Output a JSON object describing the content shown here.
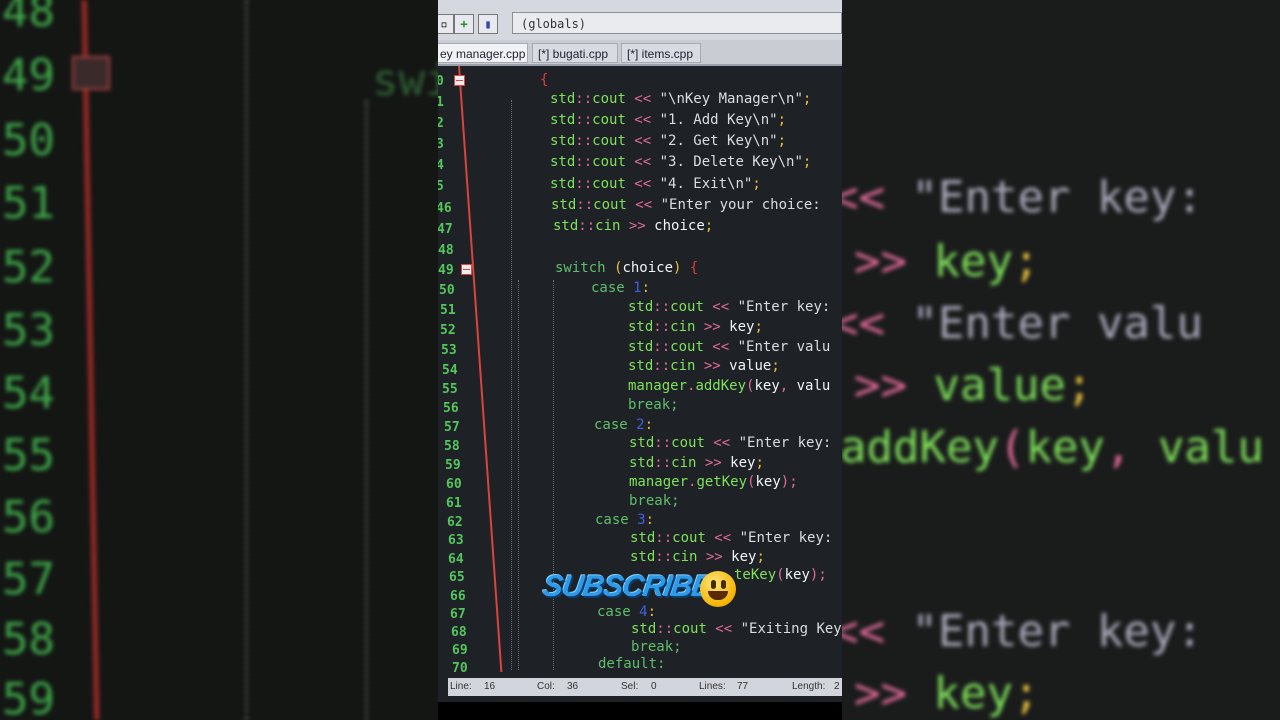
{
  "toolbar": {
    "scope": "(globals)"
  },
  "tabs": [
    {
      "label": "ey manager.cpp",
      "active": true
    },
    {
      "label": "[*] bugati.cpp",
      "active": false
    },
    {
      "label": "[*] items.cpp",
      "active": false
    }
  ],
  "gutter": {
    "top_partial": [
      "0",
      "1",
      "2",
      "3",
      "4",
      "5"
    ],
    "lines": [
      "46",
      "47",
      "48",
      "49",
      "50",
      "51",
      "52",
      "53",
      "54",
      "55",
      "56",
      "57",
      "58",
      "59",
      "60",
      "61",
      "62",
      "63",
      "64",
      "65",
      "66",
      "67",
      "68",
      "69",
      "70"
    ]
  },
  "code": {
    "l40": "{",
    "l41": [
      "std",
      "::",
      "cout",
      " << ",
      "\"\\nKey Manager\\n\"",
      ";"
    ],
    "l42": [
      "std",
      "::",
      "cout",
      " << ",
      "\"1. Add Key\\n\"",
      ";"
    ],
    "l43": [
      "std",
      "::",
      "cout",
      " << ",
      "\"2. Get Key\\n\"",
      ";"
    ],
    "l44": [
      "std",
      "::",
      "cout",
      " << ",
      "\"3. Delete Key\\n\"",
      ";"
    ],
    "l45": [
      "std",
      "::",
      "cout",
      " << ",
      "\"4. Exit\\n\"",
      ";"
    ],
    "l46": [
      "std",
      "::",
      "cout",
      " << ",
      "\"Enter your choice:"
    ],
    "l47": [
      "std",
      "::",
      "cin",
      " >> ",
      "choice",
      ";"
    ],
    "l49": [
      "switch",
      " (",
      "choice",
      ") ",
      "{"
    ],
    "l50": [
      "case",
      " ",
      "1",
      ":"
    ],
    "l51": [
      "std",
      "::",
      "cout",
      " << ",
      "\"Enter key:"
    ],
    "l52": [
      "std",
      "::",
      "cin",
      " >> ",
      "key",
      ";"
    ],
    "l53": [
      "std",
      "::",
      "cout",
      " << ",
      "\"Enter valu"
    ],
    "l54": [
      "std",
      "::",
      "cin",
      " >> ",
      "value",
      ";"
    ],
    "l55": [
      "manager",
      ".",
      "addKey",
      "(",
      "key",
      ", ",
      "valu"
    ],
    "l56": "break;",
    "l57": [
      "case",
      " ",
      "2",
      ":"
    ],
    "l58": [
      "std",
      "::",
      "cout",
      " << ",
      "\"Enter key:"
    ],
    "l59": [
      "std",
      "::",
      "cin",
      " >> ",
      "key",
      ";"
    ],
    "l60": [
      "manager",
      ".",
      "getKey",
      "(",
      "key",
      ");"
    ],
    "l61": "break;",
    "l62": [
      "case",
      " ",
      "3",
      ":"
    ],
    "l63": [
      "std",
      "::",
      "cout",
      " << ",
      "\"Enter key:"
    ],
    "l64": [
      "std",
      "::",
      "cin",
      " >> ",
      "key",
      ";"
    ],
    "l65": [
      "teKey",
      "(",
      "key",
      ");"
    ],
    "l67": [
      "case",
      " ",
      "4",
      ":"
    ],
    "l68": [
      "std",
      "::",
      "cout",
      " << ",
      "\"Exiting Key"
    ],
    "l69": "break;",
    "l70": "default:"
  },
  "status": {
    "line_label": "Line:",
    "line_value": "16",
    "col_label": "Col:",
    "col_value": "36",
    "sel_label": "Sel:",
    "sel_value": "0",
    "lines_label": "Lines:",
    "lines_value": "77",
    "length_label": "Length:",
    "length_value": "2"
  },
  "overlay": {
    "subscribe": "SUBSCRIBE"
  },
  "background_left": {
    "numbers": [
      "48",
      "49",
      "50",
      "51",
      "52",
      "53",
      "54",
      "55",
      "56",
      "57",
      "58",
      "59"
    ],
    "fragment": "swi"
  },
  "background_right": {
    "rows": [
      [
        "<<",
        "\"Enter key:"
      ],
      [
        ">>",
        "key",
        ";"
      ],
      [
        "<<",
        "\"Enter valu"
      ],
      [
        ">>",
        "value",
        ";"
      ],
      [
        "addKey",
        "(",
        "key",
        ",",
        "valu"
      ],
      [
        "<<",
        "\"Enter key:"
      ],
      [
        ">>",
        "key",
        ";"
      ]
    ]
  },
  "colors": {
    "namespace": "#7fe05a",
    "operator": "#e26a9a",
    "keyword": "#5fbf6a",
    "number": "#3d62e0",
    "gutter_line": "#d9443c"
  }
}
